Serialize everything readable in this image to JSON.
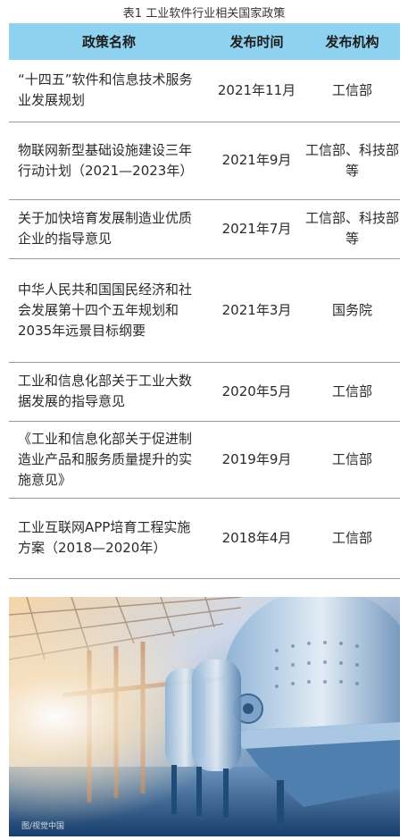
{
  "caption": "表1 工业软件行业相关国家政策",
  "table": {
    "headers": [
      "政策名称",
      "发布时间",
      "发布机构"
    ],
    "rows": [
      {
        "name": "“十四五”软件和信息技术服务业发展规划",
        "date": "2021年11月",
        "org": "工信部"
      },
      {
        "name": "物联网新型基础设施建设三年行动计划（2021—2023年）",
        "date": "2021年9月",
        "org": "工信部、科技部等"
      },
      {
        "name": "关于加快培育发展制造业优质企业的指导意见",
        "date": "2021年7月",
        "org": "工信部、科技部等"
      },
      {
        "name": "中华人民共和国国民经济和社会发展第十四个五年规划和2035年远景目标纲要",
        "date": "2021年3月",
        "org": "国务院"
      },
      {
        "name": "工业和信息化部关于工业大数据发展的指导意见",
        "date": "2020年5月",
        "org": "工信部"
      },
      {
        "name": "《工业和信息化部关于促进制造业产品和服务质量提升的实施意见》",
        "date": "2019年9月",
        "org": "工信部"
      },
      {
        "name": "工业互联网APP培育工程实施方案（2018—2020年）",
        "date": "2018年4月",
        "org": "工信部"
      }
    ]
  },
  "photo": {
    "watermark": "图/视觉中国"
  }
}
